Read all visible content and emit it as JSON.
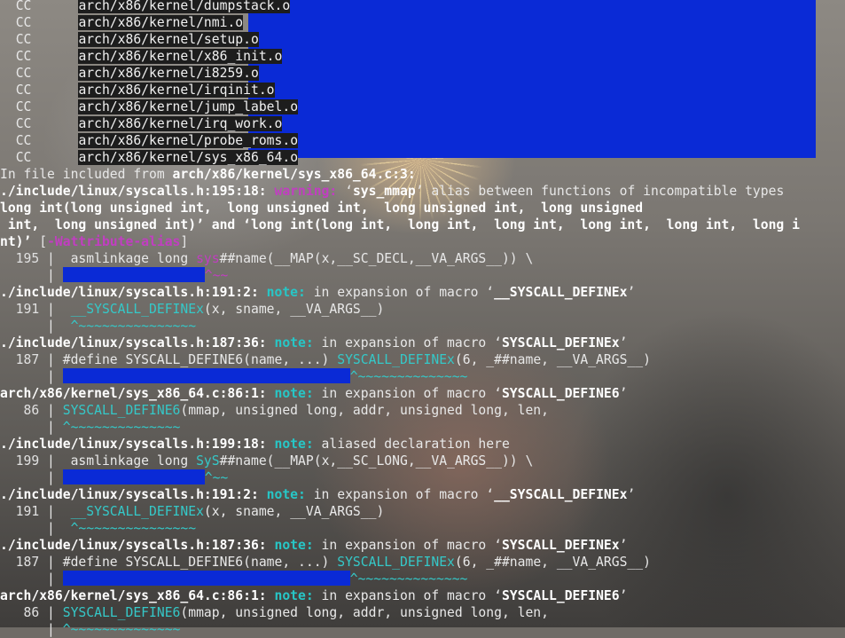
{
  "build": {
    "lines": [
      {
        "tag": "CC",
        "file": "arch/x86/kernel/dumpstack.o"
      },
      {
        "tag": "CC",
        "file": "arch/x86/kernel/nmi.o"
      },
      {
        "tag": "CC",
        "file": "arch/x86/kernel/setup.o"
      },
      {
        "tag": "CC",
        "file": "arch/x86/kernel/x86_init.o"
      },
      {
        "tag": "CC",
        "file": "arch/x86/kernel/i8259.o"
      },
      {
        "tag": "CC",
        "file": "arch/x86/kernel/irqinit.o"
      },
      {
        "tag": "CC",
        "file": "arch/x86/kernel/jump_label.o"
      },
      {
        "tag": "CC",
        "file": "arch/x86/kernel/irq_work.o"
      },
      {
        "tag": "CC",
        "file": "arch/x86/kernel/probe_roms.o"
      },
      {
        "tag": "CC",
        "file": "arch/x86/kernel/sys_x86_64.o"
      }
    ]
  },
  "diag": {
    "included_prefix": "In file included from ",
    "included_file": "arch/x86/kernel/sys_x86_64.c:3:",
    "warning": {
      "location": "./include/linux/syscalls.h:195:18:",
      "label": "warning:",
      "msg_a": " ‘",
      "symbol": "sys_mmap",
      "msg_b": "’ alias between functions of incompatible types",
      "line2": "long int(long unsigned int,  long unsigned int,  long unsigned int,  long unsigned",
      "line3_a": " int,  long unsigned int)’ and ‘",
      "line3_b": "long int(long int,  long int,  long int,  long int,  long int,  long i",
      "line4_a": "nt)’",
      "flag_open": " [",
      "flag": "-Wattribute-alias",
      "flag_close": "]"
    },
    "code195": {
      "num": "  195",
      "sep": " |  ",
      "a": "asmlinkage long ",
      "b": "sys",
      "c": "##name(__MAP(x,__SC_DECL,__VA_ARGS__)) \\"
    },
    "caret195": {
      "sep": "      | ",
      "marker": "^~~"
    },
    "note1": {
      "location": "./include/linux/syscalls.h:191:2:",
      "label": "note:",
      "msg_a": " in expansion of macro ‘",
      "macro": "__SYSCALL_DEFINEx",
      "msg_b": "’"
    },
    "code191": {
      "num": "  191",
      "sep": " |  ",
      "macro": "__SYSCALL_DEFINEx",
      "rest": "(x, sname, __VA_ARGS__)"
    },
    "caret191": {
      "sep": "      |  ",
      "marker": "^~~~~~~~~~~~~~~~"
    },
    "note2": {
      "location": "./include/linux/syscalls.h:187:36:",
      "label": "note:",
      "msg_a": " in expansion of macro ‘",
      "macro": "SYSCALL_DEFINEx",
      "msg_b": "’"
    },
    "code187": {
      "num": "  187",
      "sep": " | ",
      "a": "#define SYSCALL_DEFINE6(name, ...) ",
      "macro": "SYSCALL_DEFINEx",
      "rest": "(6, _##name, __VA_ARGS__)"
    },
    "caret187": {
      "sep": "      | ",
      "marker": "^~~~~~~~~~~~~~~"
    },
    "note3": {
      "location": "arch/x86/kernel/sys_x86_64.c:86:1:",
      "label": "note:",
      "msg_a": " in expansion of macro ‘",
      "macro": "SYSCALL_DEFINE6",
      "msg_b": "’"
    },
    "code86": {
      "num": "   86",
      "sep": " | ",
      "macro": "SYSCALL_DEFINE6",
      "rest": "(mmap, unsigned long, addr, unsigned long, len,"
    },
    "caret86": {
      "sep": "      | ",
      "marker": "^~~~~~~~~~~~~~~"
    },
    "note4": {
      "location": "./include/linux/syscalls.h:199:18:",
      "label": "note:",
      "msg": " aliased declaration here"
    },
    "code199": {
      "num": "  199",
      "sep": " |  ",
      "a": "asmlinkage long ",
      "b": "SyS",
      "c": "##name(__MAP(x,__SC_LONG,__VA_ARGS__)) \\"
    },
    "caret199": {
      "sep": "      | ",
      "marker": "^~~"
    },
    "note5": {
      "location": "./include/linux/syscalls.h:191:2:",
      "label": "note:",
      "msg_a": " in expansion of macro ‘",
      "macro": "__SYSCALL_DEFINEx",
      "msg_b": "’"
    },
    "code191b": {
      "num": "  191",
      "sep": " |  ",
      "macro": "__SYSCALL_DEFINEx",
      "rest": "(x, sname, __VA_ARGS__)"
    },
    "caret191b": {
      "sep": "      |  ",
      "marker": "^~~~~~~~~~~~~~~~"
    },
    "note6": {
      "location": "./include/linux/syscalls.h:187:36:",
      "label": "note:",
      "msg_a": " in expansion of macro ‘",
      "macro": "SYSCALL_DEFINEx",
      "msg_b": "’"
    },
    "code187b": {
      "num": "  187",
      "sep": " | ",
      "a": "#define SYSCALL_DEFINE6(name, ...) ",
      "macro": "SYSCALL_DEFINEx",
      "rest": "(6, _##name, __VA_ARGS__)"
    },
    "caret187b": {
      "sep": "      | ",
      "marker": "^~~~~~~~~~~~~~~"
    },
    "note7": {
      "location": "arch/x86/kernel/sys_x86_64.c:86:1:",
      "label": "note:",
      "msg_a": " in expansion of macro ‘",
      "macro": "SYSCALL_DEFINE6",
      "msg_b": "’"
    },
    "code86b": {
      "num": "   86",
      "sep": " | ",
      "macro": "SYSCALL_DEFINE6",
      "rest": "(mmap, unsigned long, addr, unsigned long, len,"
    },
    "caret86b": {
      "sep": "      | ",
      "marker": "^~~~~~~~~~~~~~~"
    }
  },
  "colors": {
    "redaction": "#0a2ad6",
    "warning": "#c13ec1",
    "note": "#27c6c6"
  }
}
